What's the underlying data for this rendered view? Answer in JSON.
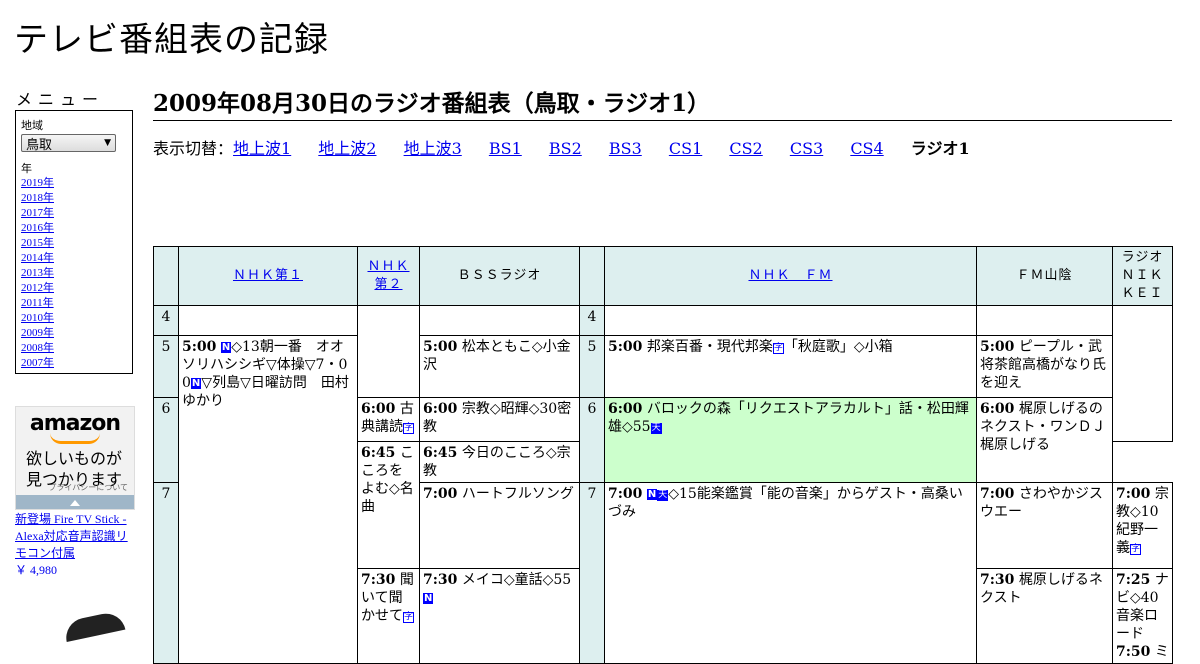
{
  "site_title": "テレビ番組表の記録",
  "menu": {
    "heading": "メニュー",
    "region_label": "地域",
    "region_value": "鳥取",
    "year_label": "年",
    "years": [
      "2019年",
      "2018年",
      "2017年",
      "2016年",
      "2015年",
      "2014年",
      "2013年",
      "2012年",
      "2011年",
      "2010年",
      "2009年",
      "2008年",
      "2007年"
    ]
  },
  "ad": {
    "logo": "amazon",
    "copy_line1": "欲しいものが",
    "copy_line2": "見つかります",
    "privacy": "プライバシーについて",
    "product": "新登場 Fire TV Stick - Alexa対応音声認識リモコン付属",
    "price": "￥ 4,980"
  },
  "page_title": "2009年08月30日のラジオ番組表（鳥取・ラジオ1）",
  "switcher": {
    "label": "表示切替：",
    "links": [
      "地上波1",
      "地上波2",
      "地上波3",
      "BS1",
      "BS2",
      "BS3",
      "CS1",
      "CS2",
      "CS3",
      "CS4"
    ],
    "current": "ラジオ1"
  },
  "channels": {
    "nhk1": "ＮＨＫ第１",
    "nhk2": "ＮＨＫ第２",
    "bss": "ＢＳＳラジオ",
    "nhkfm": "ＮＨＫ　ＦＭ",
    "fmsanin": "ＦＭ山陰",
    "nikkei": "ラジオＮＩＫＫＥＩ"
  },
  "hours": [
    "4",
    "5",
    "6",
    "7"
  ],
  "programs": {
    "nhk1_500": {
      "time": "5:00",
      "pre": "",
      "post": "◇13朝一番　オオソリハシシギ▽体操▽7・00",
      "post2": "▽列島▽日曜訪問　田村ゆかり"
    },
    "nhk2_600": {
      "time": "6:00",
      "text": "古典講読"
    },
    "nhk2_645": {
      "time": "6:45",
      "text": "こころをよむ◇名曲"
    },
    "nhk2_730": {
      "time": "7:30",
      "text": "聞いて聞かせて"
    },
    "bss_500": {
      "time": "5:00",
      "text": "松本ともこ◇小金沢"
    },
    "bss_600": {
      "time": "6:00",
      "text": "宗教◇昭輝◇30密教"
    },
    "bss_645": {
      "time": "6:45",
      "text": "今日のこころ◇宗教"
    },
    "bss_700": {
      "time": "7:00",
      "text": "ハートフルソング"
    },
    "bss_730": {
      "time": "7:30",
      "text": "メイコ◇童話◇55"
    },
    "fm_500": {
      "time": "5:00",
      "text": "邦楽百番・現代邦楽",
      "text2": "「秋庭歌」◇小箱"
    },
    "fm_600": {
      "time": "6:00",
      "text": "バロックの森「リクエストアラカルト」話・松田輝雄◇55"
    },
    "fm_700": {
      "time": "7:00",
      "text": "◇15能楽鑑賞「能の音楽」からゲスト・高桑いづみ"
    },
    "sanin_500": {
      "time": "5:00",
      "text": "ピープル・武将茶館高橋がなり氏を迎え"
    },
    "sanin_600": {
      "time": "6:00",
      "text": "梶原しげるのネクスト・ワンＤＪ梶原しげる"
    },
    "sanin_700": {
      "time": "7:00",
      "text": "さわやかジスウエー"
    },
    "sanin_730": {
      "time": "7:30",
      "text": "梶原しげるネクスト"
    },
    "nikkei_700": {
      "time": "7:00",
      "text": "宗教◇10紀野一義"
    },
    "nikkei_725": {
      "time": "7:25",
      "text": "ナビ◇40音楽ロード"
    },
    "nikkei_750": {
      "time": "7:50",
      "text": "ミ"
    }
  },
  "badges": {
    "news": "N",
    "sub": "字",
    "ten": "天"
  }
}
